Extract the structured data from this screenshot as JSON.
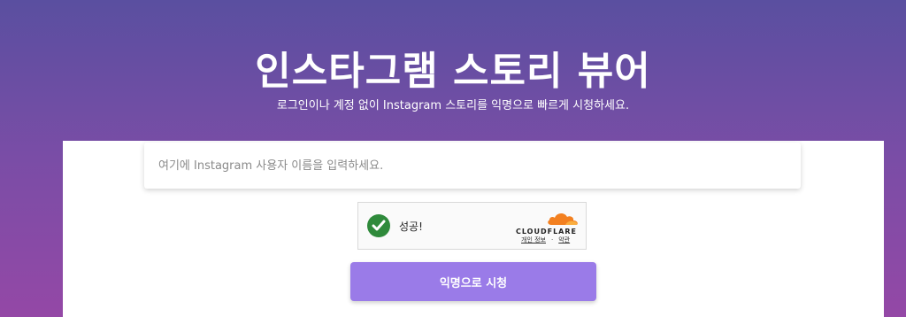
{
  "hero": {
    "title": "인스타그램 스토리 뷰어",
    "subtitle": "로그인이나 계정 없이 Instagram 스토리를 익명으로 빠르게 시청하세요."
  },
  "search": {
    "placeholder": "여기에 Instagram 사용자 이름을 입력하세요.",
    "value": ""
  },
  "captcha": {
    "status": "성공!",
    "brand": "CLOUDFLARE",
    "privacy_link": "개인 정보",
    "separator": "·",
    "terms_link": "약관",
    "check_color": "#2f8a3b",
    "logo_color": "#f38020"
  },
  "actions": {
    "submit_label": "익명으로 시청",
    "submit_color": "#9a7be8"
  },
  "colors": {
    "background_top": "#5a4fa0",
    "background_bottom": "#9448a6"
  }
}
